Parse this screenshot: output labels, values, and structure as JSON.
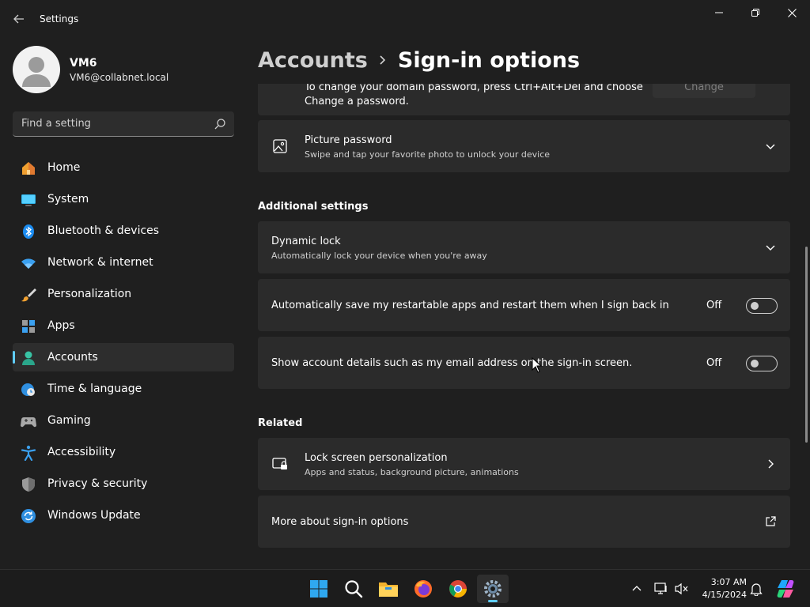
{
  "app": {
    "title": "Settings"
  },
  "profile": {
    "name": "VM6",
    "email": "VM6@collabnet.local"
  },
  "search": {
    "placeholder": "Find a setting"
  },
  "nav": [
    {
      "label": "Home",
      "icon": "home-icon"
    },
    {
      "label": "System",
      "icon": "system-icon"
    },
    {
      "label": "Bluetooth & devices",
      "icon": "bluetooth-icon"
    },
    {
      "label": "Network & internet",
      "icon": "wifi-icon"
    },
    {
      "label": "Personalization",
      "icon": "brush-icon"
    },
    {
      "label": "Apps",
      "icon": "apps-icon"
    },
    {
      "label": "Accounts",
      "icon": "person-icon",
      "active": true
    },
    {
      "label": "Time & language",
      "icon": "globe-clock-icon"
    },
    {
      "label": "Gaming",
      "icon": "gamepad-icon"
    },
    {
      "label": "Accessibility",
      "icon": "accessibility-icon"
    },
    {
      "label": "Privacy & security",
      "icon": "shield-icon"
    },
    {
      "label": "Windows Update",
      "icon": "update-icon"
    }
  ],
  "breadcrumb": {
    "parent": "Accounts",
    "current": "Sign-in options"
  },
  "password_card": {
    "line1": "To change your domain password, press Ctrl+Alt+Del and choose",
    "line2": "Change a password.",
    "button": "Change"
  },
  "picture_password": {
    "title": "Picture password",
    "subtitle": "Swipe and tap your favorite photo to unlock your device"
  },
  "additional_settings": {
    "heading": "Additional settings",
    "dynamic_lock": {
      "title": "Dynamic lock",
      "subtitle": "Automatically lock your device when you're away"
    },
    "restart_apps": {
      "title": "Automatically save my restartable apps and restart them when I sign back in",
      "state": "Off"
    },
    "account_details": {
      "title": "Show account details such as my email address on the sign-in screen.",
      "state": "Off"
    }
  },
  "related": {
    "heading": "Related",
    "lock_screen": {
      "title": "Lock screen personalization",
      "subtitle": "Apps and status, background picture, animations"
    },
    "more_about": {
      "title": "More about sign-in options"
    }
  },
  "taskbar": {
    "time": "3:07 AM",
    "date": "4/15/2024",
    "apps": [
      "start-icon",
      "search-icon",
      "file-explorer-icon",
      "firefox-icon",
      "chrome-icon",
      "settings-icon"
    ]
  },
  "colors": {
    "accent": "#60cdff",
    "background": "#1f1f1f",
    "card": "#2b2b2b"
  }
}
